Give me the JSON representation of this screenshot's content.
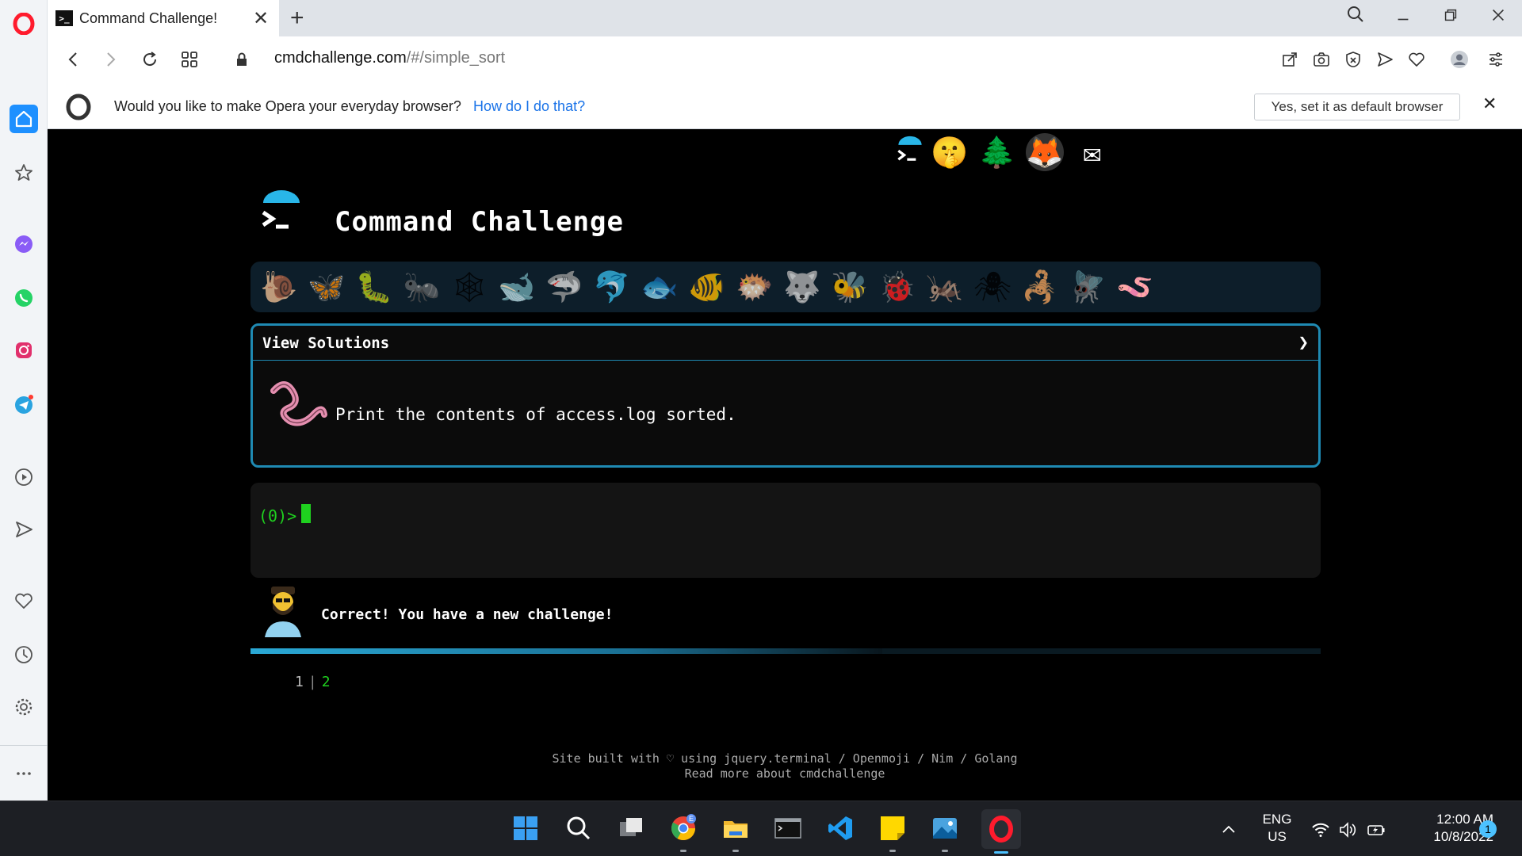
{
  "browser": {
    "tab_title": "Command Challenge!",
    "tab_favicon": ">_",
    "new_tab_glyph": "+",
    "url_host": "cmdchallenge.com",
    "url_path": "/#/simple_sort",
    "close_glyph": "✕"
  },
  "infobar": {
    "message": "Would you like to make Opera your everyday browser?",
    "link": "How do I do that?",
    "button": "Yes, set it as default browser",
    "close": "✕"
  },
  "header_icons": [
    "terminal-logo-icon",
    "shushing-face-icon",
    "evergreen-tree-icon",
    "gitlab-fox-icon",
    "envelope-icon"
  ],
  "header_icon_glyphs": [
    "",
    "🤫",
    "🌲",
    "🦊",
    "✉"
  ],
  "site": {
    "title": "Command Challenge"
  },
  "ladder": [
    {
      "name": "snail",
      "glyph": "🐌"
    },
    {
      "name": "butterfly",
      "glyph": "🦋"
    },
    {
      "name": "caterpillar",
      "glyph": "🐛"
    },
    {
      "name": "ant",
      "glyph": "🐜"
    },
    {
      "name": "spider-web",
      "glyph": "🕸"
    },
    {
      "name": "whale",
      "glyph": "🐋"
    },
    {
      "name": "shark",
      "glyph": "🦈"
    },
    {
      "name": "dolphin",
      "glyph": "🐬"
    },
    {
      "name": "fish",
      "glyph": "🐟"
    },
    {
      "name": "tropical-fish",
      "glyph": "🐠"
    },
    {
      "name": "blowfish",
      "glyph": "🐡"
    },
    {
      "name": "wolf",
      "glyph": "🐺"
    },
    {
      "name": "bee",
      "glyph": "🐝"
    },
    {
      "name": "lady-beetle",
      "glyph": "🐞"
    },
    {
      "name": "cricket",
      "glyph": "🦗"
    },
    {
      "name": "spider",
      "glyph": "🕷"
    },
    {
      "name": "scorpion",
      "glyph": "🦂"
    },
    {
      "name": "fly",
      "glyph": "🪰"
    },
    {
      "name": "worm",
      "glyph": "🪱"
    }
  ],
  "challenge": {
    "header": "View Solutions",
    "arrow": "❯",
    "text": "Print the contents of access.log sorted."
  },
  "terminal": {
    "prompt": "(0)>"
  },
  "feedback": {
    "text": "Correct! You have a new challenge!"
  },
  "progress": {
    "fraction": 0.59
  },
  "pager": {
    "pages": [
      "1",
      "2"
    ],
    "separator": "|",
    "active_index": 1
  },
  "footer": {
    "line1": "Site built with ♡ using jquery.terminal / Openmoji / Nim / Golang",
    "line2": "Read more about cmdchallenge"
  },
  "taskbar": {
    "lang_line1": "ENG",
    "lang_line2": "US",
    "time": "12:00 AM",
    "date": "10/8/2022",
    "notifications": "1",
    "chevron": "^",
    "chrome_badge": "E"
  },
  "colors": {
    "accent": "#1f8ab3",
    "terminal_green": "#1fd11f",
    "opera_red": "#ff1b2d"
  }
}
